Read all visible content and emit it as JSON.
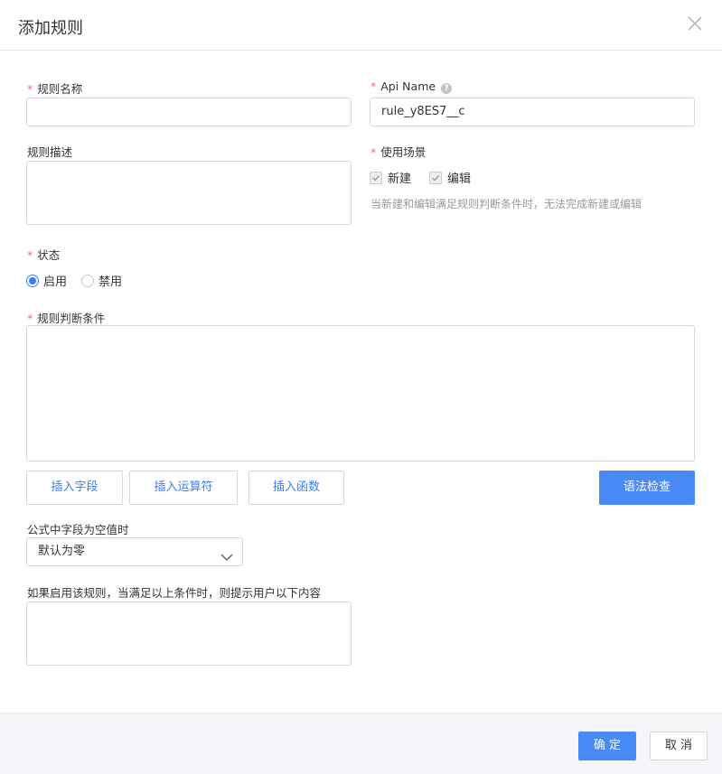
{
  "dialog": {
    "title": "添加规则",
    "close_icon": "close-icon"
  },
  "form": {
    "rule_name": {
      "required_mark": "*",
      "label": "规则名称",
      "value": ""
    },
    "api_name": {
      "required_mark": "*",
      "label": "Api Name",
      "help_icon": "help-icon",
      "help_glyph": "?",
      "value": "rule_y8ES7__c"
    },
    "description": {
      "label": "规则描述",
      "value": ""
    },
    "usage": {
      "required_mark": "*",
      "label": "使用场景",
      "options": [
        {
          "label": "新建",
          "checked": true
        },
        {
          "label": "编辑",
          "checked": true
        }
      ],
      "hint": "当新建和编辑满足规则判断条件时，无法完成新建或编辑"
    },
    "status": {
      "required_mark": "*",
      "label": "状态",
      "options": [
        {
          "label": "启用",
          "selected": true
        },
        {
          "label": "禁用",
          "selected": false
        }
      ]
    },
    "condition": {
      "required_mark": "*",
      "label": "规则判断条件",
      "value": "",
      "buttons": {
        "insert_field": "插入字段",
        "insert_operator": "插入运算符",
        "insert_function": "插入函数",
        "syntax_check": "语法检查"
      }
    },
    "empty_field": {
      "label": "公式中字段为空值时",
      "selected": "默认为零"
    },
    "message": {
      "label": "如果启用该规则，当满足以上条件时，则提示用户以下内容",
      "value": ""
    }
  },
  "footer": {
    "ok_label": "确 定",
    "cancel_label": "取 消"
  },
  "colors": {
    "primary": "#4a8af7",
    "required": "#f56c6c",
    "footer_bg": "#f5f6fa"
  }
}
